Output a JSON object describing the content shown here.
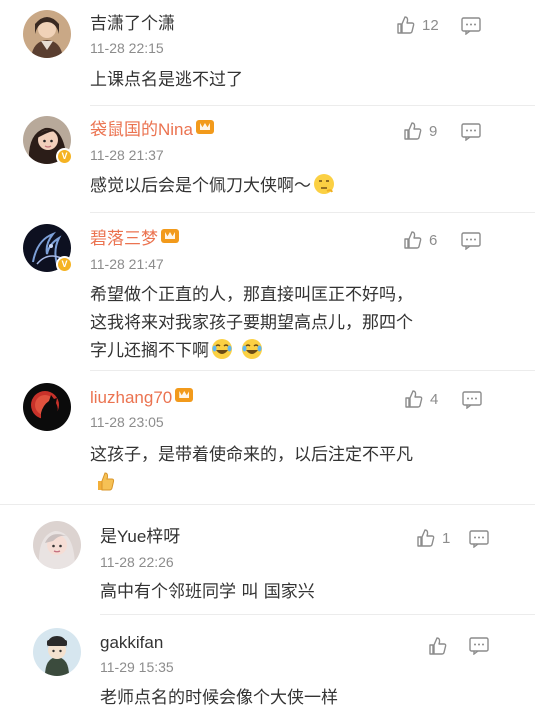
{
  "comments": [
    {
      "user": "吉潇了个潇",
      "time": "11-28 22:15",
      "likes": "12",
      "text": "上课点名是逃不过了"
    },
    {
      "user": "袋鼠国的Nina",
      "time": "11-28 21:37",
      "likes": "9",
      "text": "感觉以后会是个佩刀大侠啊～"
    },
    {
      "user": "碧落三梦",
      "time": "11-28 21:47",
      "likes": "6",
      "text_line1": "希望做个正直的人，那直接叫匡正不好吗，",
      "text_line2": "这我将来对我家孩子要期望高点儿，那四个",
      "text_line3": "字儿还搁不下啊"
    },
    {
      "user": "liuzhang70",
      "time": "11-28 23:05",
      "likes": "4",
      "text": "这孩子，是带着使命来的，以后注定不平凡"
    },
    {
      "user": "是Yue梓呀",
      "time": "11-28 22:26",
      "likes": "1",
      "text": "高中有个邻班同学 叫 国家兴"
    },
    {
      "user": "gakkifan",
      "time": "11-29 15:35",
      "likes": "",
      "text": "老师点名的时候会像个大侠一样"
    }
  ],
  "badges": {
    "verified": "V"
  },
  "icons": {
    "like": "thumbs-up-icon",
    "reply": "comment-bubble-icon",
    "vip": "vip-crown-icon"
  },
  "colors": {
    "accent_name": "#eb7350",
    "meta": "#8c8c8c",
    "badge": "#f5b323"
  }
}
